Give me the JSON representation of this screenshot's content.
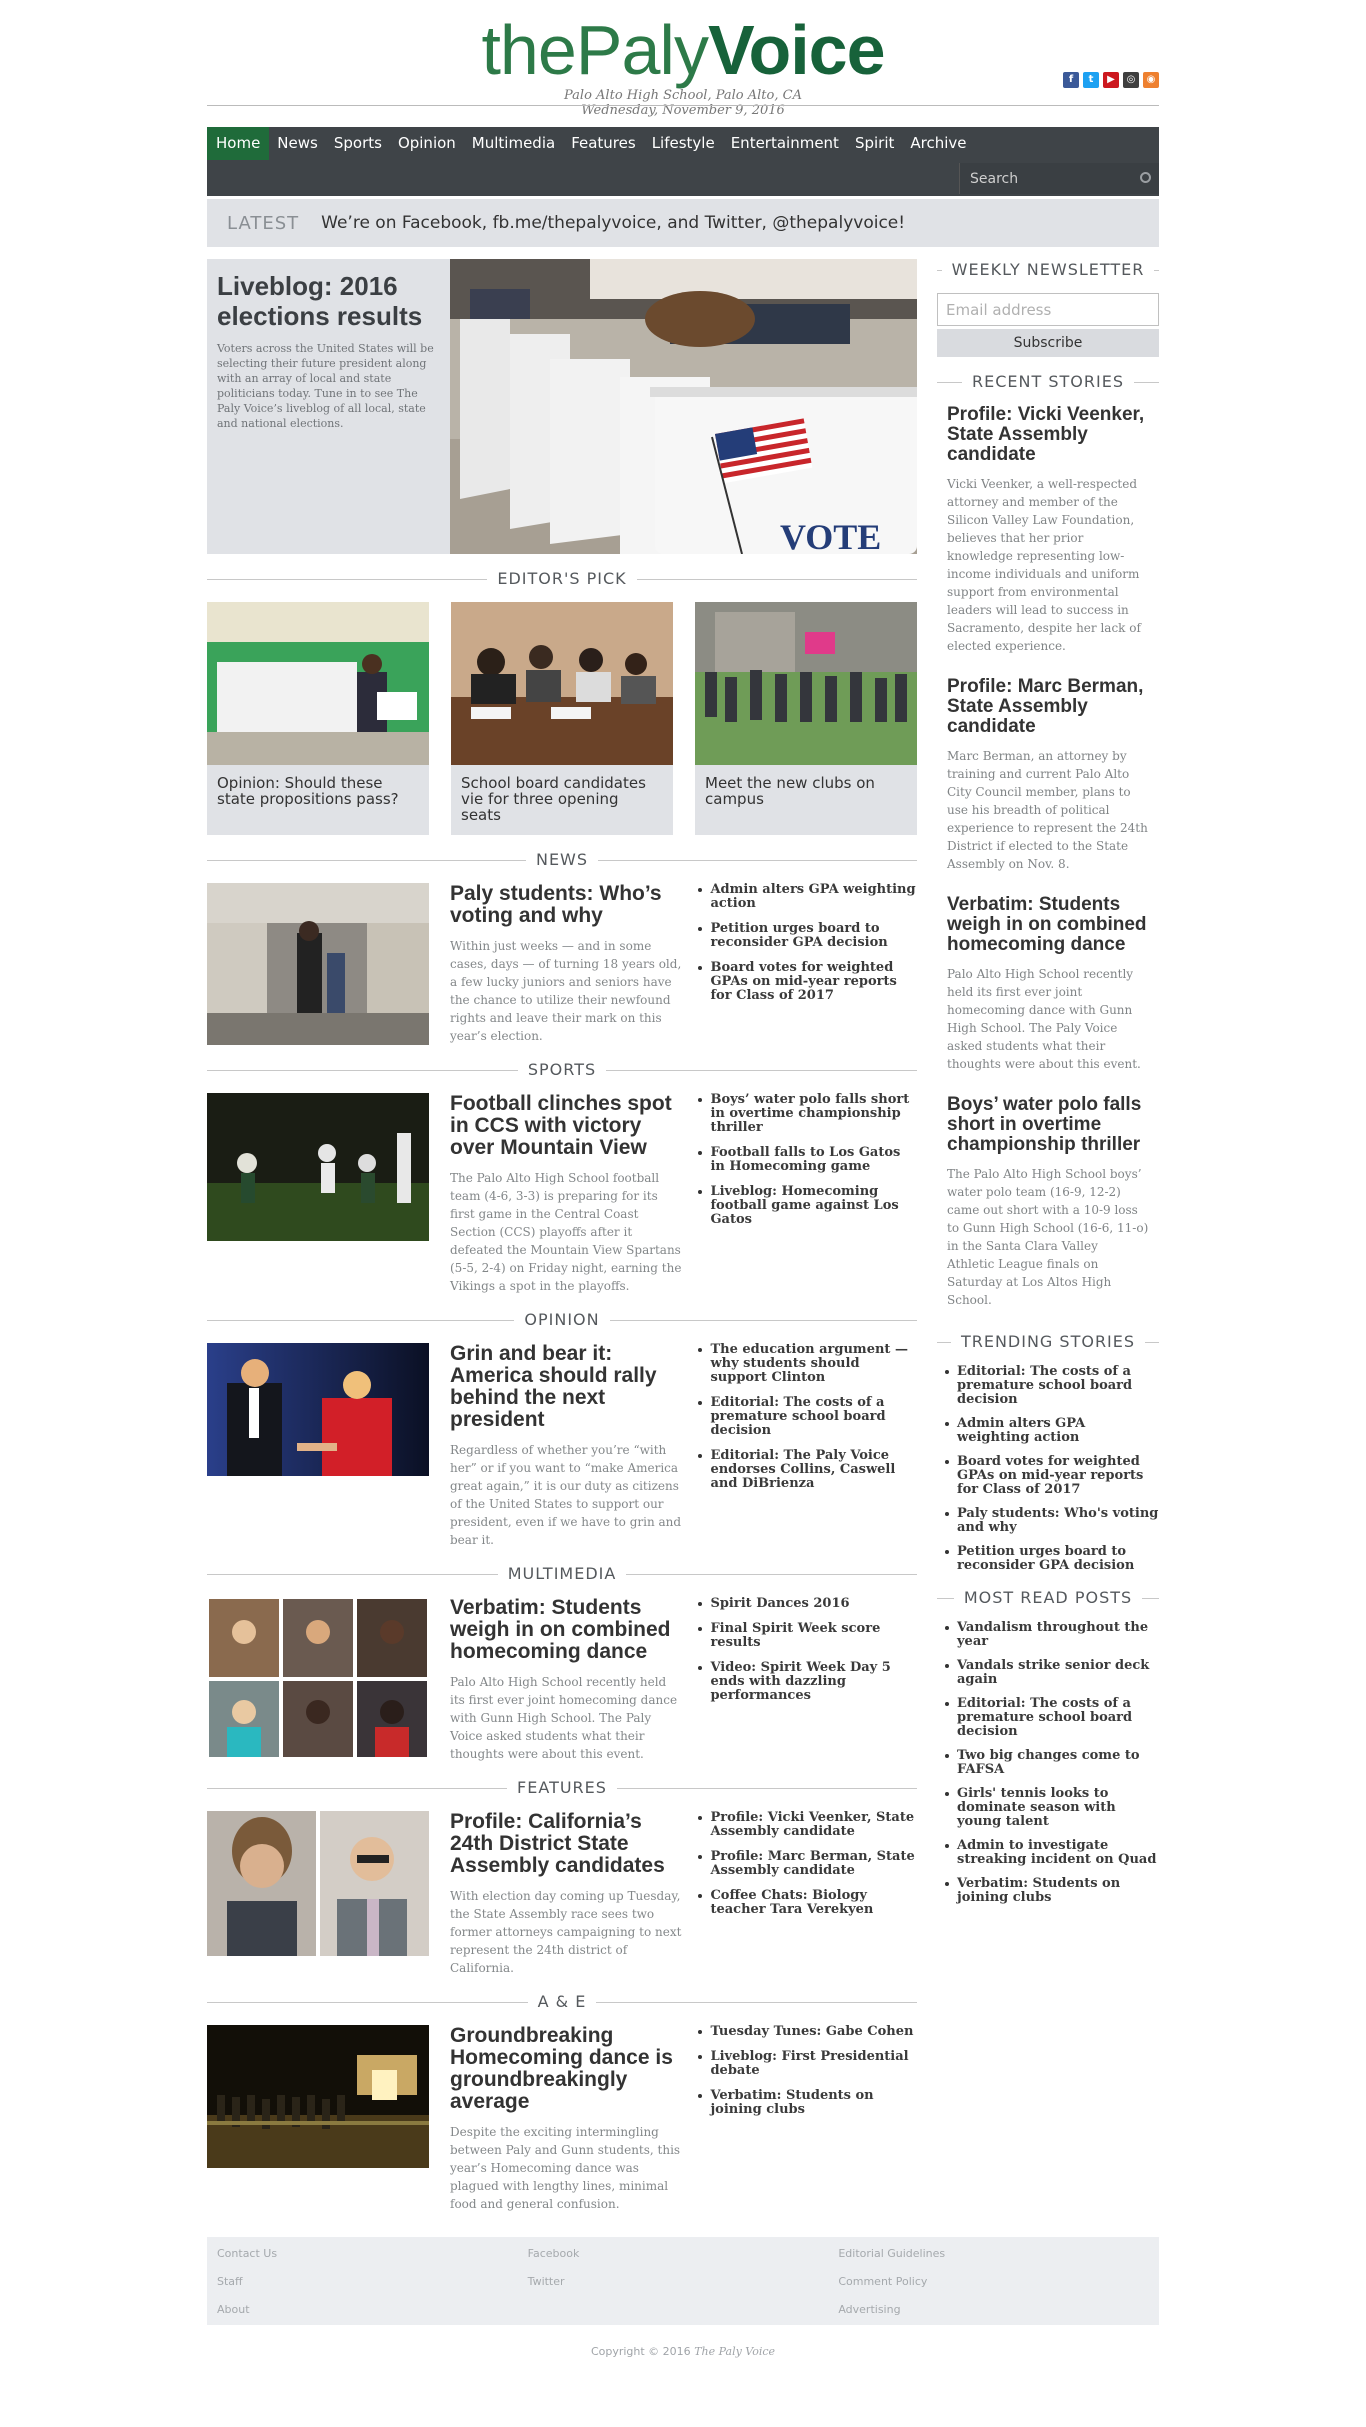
{
  "masthead": {
    "logo_pre": "the",
    "logo_mid": "Paly",
    "logo_bold": "Voice",
    "location": "Palo Alto High School, Palo Alto, CA",
    "date": "Wednesday, November 9, 2016",
    "social": [
      {
        "name": "facebook-icon",
        "color": "#3b5998",
        "glyph": "f"
      },
      {
        "name": "twitter-icon",
        "color": "#1da1f2",
        "glyph": "t"
      },
      {
        "name": "youtube-icon",
        "color": "#cc181e",
        "glyph": "▶"
      },
      {
        "name": "instagram-icon",
        "color": "#3f3f3f",
        "glyph": "◎"
      },
      {
        "name": "rss-icon",
        "color": "#ee802f",
        "glyph": "◉"
      }
    ]
  },
  "nav": {
    "items": [
      "Home",
      "News",
      "Sports",
      "Opinion",
      "Multimedia",
      "Features",
      "Lifestyle",
      "Entertainment",
      "Spirit",
      "Archive"
    ],
    "active": "Home",
    "search_placeholder": "Search"
  },
  "latest": {
    "label": "LATEST",
    "text": "We’re on Facebook, fb.me/thepalyvoice, and Twitter, @thepalyvoice!"
  },
  "hero": {
    "title": "Liveblog: 2016 elections results",
    "summary": "Voters across the United States will be selecting their future president along with an array of local and state politicians today. Tune in to see The Paly Voice’s liveblog of all local, state and national elections.",
    "image_sign_text": "VOTE"
  },
  "editors_pick": {
    "heading": "EDITOR'S PICK",
    "items": [
      {
        "title": "Opinion: Should these state propositions pass?"
      },
      {
        "title": "School board candidates vie for three opening seats"
      },
      {
        "title": "Meet the new clubs on campus"
      }
    ]
  },
  "sections": [
    {
      "heading": "NEWS",
      "title": "Paly students: Who’s voting and why",
      "summary": "Within just weeks — and in some cases, days — of turning 18 years old, a few lucky juniors and seniors have the chance to utilize their newfound rights and leave their mark on this year’s election.",
      "links": [
        "Admin alters GPA weighting action",
        "Petition urges board to reconsider GPA decision",
        "Board votes for weighted GPAs on mid-year reports for Class of 2017"
      ]
    },
    {
      "heading": "SPORTS",
      "title": "Football clinches spot in CCS with victory over Mountain View",
      "summary": "The Palo Alto High School football team (4-6, 3-3) is preparing for its first game in the Central Coast Section (CCS) playoffs after it defeated the Mountain View Spartans (5-5, 2-4) on Friday night, earning the Vikings a spot in the playoffs.",
      "links": [
        "Boys’ water polo falls short in overtime championship thriller",
        "Football falls to Los Gatos in Homecoming game",
        "Liveblog: Homecoming football game against Los Gatos"
      ]
    },
    {
      "heading": "OPINION",
      "title": "Grin and bear it: America should rally behind the next president",
      "summary": "Regardless of whether you’re “with her” or if you want to “make America great again,” it is our duty as citizens of the United States to support our president, even if we have to grin and bear it.",
      "links": [
        "The education argument — why students should support Clinton",
        "Editorial: The costs of a premature school board decision",
        "Editorial: The Paly Voice endorses Collins, Caswell and DiBrienza"
      ]
    },
    {
      "heading": "MULTIMEDIA",
      "title": "Verbatim: Students weigh in on combined homecoming dance",
      "summary": "Palo Alto High School recently held its first ever joint homecoming dance with Gunn High School. The Paly Voice asked students what their thoughts were about this event.",
      "links": [
        "Spirit Dances 2016",
        "Final Spirit Week score results",
        "Video: Spirit Week Day 5 ends with dazzling performances"
      ]
    },
    {
      "heading": "FEATURES",
      "title": "Profile: California’s 24th District State Assembly candidates",
      "summary": "With election day coming up Tuesday, the State Assembly race sees two former attorneys campaigning to next represent the 24th district of California.",
      "links": [
        "Profile: Vicki Veenker, State Assembly candidate",
        "Profile: Marc Berman, State Assembly candidate",
        "Coffee Chats: Biology teacher Tara Verekyen"
      ]
    },
    {
      "heading": "A & E",
      "title": "Groundbreaking Homecoming dance is groundbreakingly average",
      "summary": "Despite the exciting intermingling between Paly and Gunn students, this year’s Homecoming dance was plagued with lengthy lines, minimal food and general confusion.",
      "links": [
        "Tuesday Tunes: Gabe Cohen",
        "Liveblog: First Presidential debate",
        "Verbatim: Students on joining clubs"
      ]
    }
  ],
  "sidebar": {
    "newsletter_heading": "WEEKLY NEWSLETTER",
    "email_placeholder": "Email address",
    "subscribe_label": "Subscribe",
    "recent_heading": "RECENT STORIES",
    "recent": [
      {
        "title": "Profile: Vicki Veenker, State Assembly candidate",
        "summary": "Vicki Veenker, a well-respected attorney and member of the Silicon Valley Law Foundation, believes that her prior knowledge representing low-income individuals and uniform support from environmental leaders will lead to success in Sacramento, despite her lack of elected experience."
      },
      {
        "title": "Profile: Marc Berman, State Assembly candidate",
        "summary": "Marc Berman, an attorney by training and current Palo Alto City Council member, plans to use his breadth of political experience to represent the 24th District if elected to the State Assembly on Nov. 8."
      },
      {
        "title": "Verbatim: Students weigh in on combined homecoming dance",
        "summary": "Palo Alto High School recently held its first ever joint homecoming dance with Gunn High School. The Paly Voice asked students what their thoughts were about this event."
      },
      {
        "title": "Boys’ water polo falls short in overtime championship thriller",
        "summary": "The Palo Alto High School boys’ water polo team (16-9, 12-2) came out short with a 10-9 loss to Gunn High School (16-6, 11-o) in the Santa Clara Valley Athletic League finals on Saturday at Los Altos High School."
      }
    ],
    "trending_heading": "TRENDING STORIES",
    "trending": [
      "Editorial: The costs of a premature school board decision",
      "Admin alters GPA weighting action",
      "Board votes for weighted GPAs on mid-year reports for Class of 2017",
      "Paly students: Who's voting and why",
      "Petition urges board to reconsider GPA decision"
    ],
    "mostread_heading": "MOST READ POSTS",
    "mostread": [
      "Vandalism throughout the year",
      "Vandals strike senior deck again",
      "Editorial: The costs of a premature school board decision",
      "Two big changes come to FAFSA",
      "Girls' tennis looks to dominate season with young talent",
      "Admin to investigate streaking incident on Quad",
      "Verbatim: Students on joining clubs"
    ]
  },
  "footer": {
    "columns": [
      [
        "Contact Us",
        "Staff",
        "About"
      ],
      [
        "Facebook",
        "Twitter"
      ],
      [
        "Editorial Guidelines",
        "Comment Policy",
        "Advertising"
      ]
    ],
    "copyright_prefix": "Copyright © 2016",
    "copyright_name": "The Paly Voice"
  }
}
